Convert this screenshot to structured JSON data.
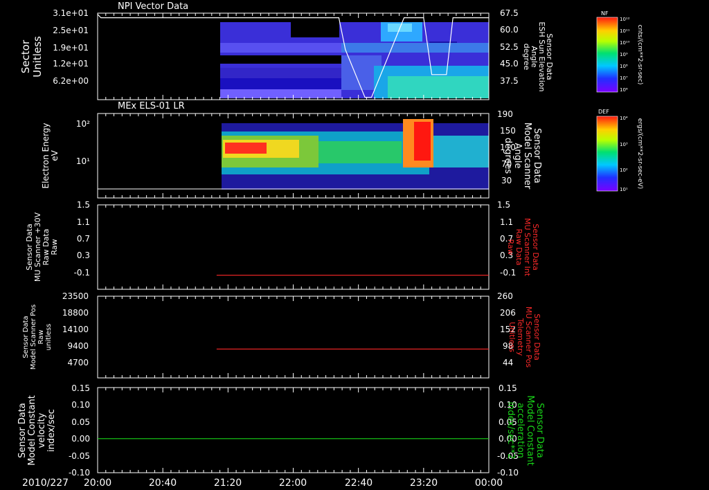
{
  "colors": {
    "background": "#000000",
    "axis": "#ffffff",
    "trace_red": "#ff2a2a",
    "trace_green": "#19d619",
    "trace_white": "#ffffff"
  },
  "xaxis": {
    "date_label": "2010/227",
    "ticks": [
      "20:00",
      "20:40",
      "21:20",
      "22:00",
      "22:40",
      "23:20",
      "00:00"
    ]
  },
  "panels": {
    "npi": {
      "title": "NPI Vector Data",
      "left_label": [
        "Sector",
        "Unitless"
      ],
      "left_ticks": [
        "3.1e+01",
        "2.5e+01",
        "1.9e+01",
        "1.2e+01",
        "6.2e+00"
      ],
      "right_label": [
        "Sensor Data",
        "ESH Sun Elevation",
        "Angle",
        "degree"
      ],
      "right_ticks": [
        "67.5",
        "60.0",
        "52.5",
        "45.0",
        "37.5"
      ]
    },
    "els": {
      "title": "MEx ELS-01 LR",
      "left_label": [
        "Electron Energy",
        "eV"
      ],
      "left_ticks": [
        "10²",
        "10¹"
      ],
      "right_label": [
        "Sensor Data",
        "Model Scanner",
        "Angle",
        "degrees"
      ],
      "right_ticks": [
        "190",
        "150",
        "110",
        "70",
        "30"
      ]
    },
    "mu_raw": {
      "left_label": [
        "Sensor Data",
        "MU Scanner +30V",
        "Raw Data",
        "Raw"
      ],
      "left_ticks": [
        "1.5",
        "1.1",
        "0.7",
        "0.3",
        "-0.1"
      ],
      "right_label": [
        "Sensor Data",
        "MU Scanner Int",
        "Raw Data",
        "Raw"
      ],
      "right_ticks": [
        "1.5",
        "1.1",
        "0.7",
        "0.3",
        "-0.1"
      ]
    },
    "pos": {
      "left_label": [
        "Sensor Data",
        "Model Scanner Pos",
        "Raw",
        "unitless"
      ],
      "left_ticks": [
        "23500",
        "18800",
        "14100",
        "9400",
        "4700"
      ],
      "right_label": [
        "Sensor Data",
        "MU Scanner Pos",
        "Telemetry",
        "Unitless"
      ],
      "right_ticks": [
        "260",
        "206",
        "152",
        "98",
        "44"
      ]
    },
    "vel": {
      "left_label": [
        "Sensor Data",
        "Model Constant",
        "velocity",
        "index/sec"
      ],
      "left_ticks": [
        "0.15",
        "0.10",
        "0.05",
        "0.00",
        "-0.05",
        "-0.10"
      ],
      "right_label": [
        "Sensor Data",
        "Model Constant",
        "acceleration",
        "index/sec**2"
      ],
      "right_ticks": [
        "0.15",
        "0.10",
        "0.05",
        "0.00",
        "-0.05",
        "-0.10"
      ]
    }
  },
  "colorbars": {
    "npi": {
      "title": "NF",
      "ticks": [
        "10¹²",
        "10¹¹",
        "10¹⁰",
        "10⁹",
        "10⁸",
        "10⁷",
        "10⁶"
      ],
      "unit": "cnts/(cm**2-sr-sec)"
    },
    "els": {
      "title": "DEF",
      "ticks": [
        "10⁴",
        "10³",
        "10²",
        "10¹"
      ],
      "unit": "ergs/(cm**2-sr-sec-eV)"
    }
  },
  "chart_data": [
    {
      "type": "heatmap",
      "title": "NPI Vector Data",
      "ylabel": "Sector Unitless",
      "y2label": "Sensor Data ESH Sun Elevation Angle degree",
      "xlim": [
        "20:00",
        "00:00"
      ],
      "data_start": "21:13",
      "ylim": [
        0,
        32
      ],
      "y2lim": [
        30,
        68
      ],
      "overlay_line_y2": {
        "x": [
          "20:00",
          "20:02",
          "22:28",
          "22:32",
          "22:44",
          "22:48",
          "23:08",
          "23:12",
          "23:20",
          "23:25",
          "23:34",
          "23:38",
          "00:00"
        ],
        "y": [
          67.5,
          66.0,
          66.0,
          52,
          31,
          31,
          66.0,
          66.0,
          66.0,
          41,
          41,
          66.0,
          66.0
        ]
      }
    },
    {
      "type": "heatmap",
      "title": "MEx ELS-01 LR",
      "ylabel": "Electron Energy eV",
      "y2label": "Sensor Data Model Scanner Angle degrees",
      "xlim": [
        "20:00",
        "00:00"
      ],
      "data_start": "21:13",
      "y_scale": "log",
      "ylim": [
        1,
        200
      ],
      "y2lim": [
        10,
        190
      ],
      "overlay_line_y2": {
        "x": [
          "20:00",
          "00:00"
        ],
        "y": [
          10,
          10
        ]
      }
    },
    {
      "type": "line",
      "ylabel": "Sensor Data MU Scanner +30V Raw Data Raw",
      "y2label": "Sensor Data MU Scanner Int Raw Data Raw",
      "ylim": [
        -0.3,
        1.5
      ],
      "series": [
        {
          "x": [
            "21:13",
            "00:00"
          ],
          "values": [
            0.0,
            0.0
          ],
          "color": "#ff2a2a"
        }
      ]
    },
    {
      "type": "line",
      "ylabel": "Sensor Data Model Scanner Pos Raw unitless",
      "y2label": "Sensor Data MU Scanner Pos Telemetry Unitless",
      "ylim": [
        0,
        23500
      ],
      "series": [
        {
          "x": [
            "21:13",
            "00:00"
          ],
          "values": [
            8300,
            8300
          ],
          "color": "#ff2a2a"
        }
      ]
    },
    {
      "type": "line",
      "ylabel": "Sensor Data Model Constant velocity index/sec",
      "y2label": "Sensor Data Model Constant acceleration index/sec**2",
      "ylim": [
        -0.1,
        0.15
      ],
      "series": [
        {
          "x": [
            "20:00",
            "00:00"
          ],
          "values": [
            0.0,
            0.0
          ],
          "color": "#19d619"
        }
      ]
    }
  ]
}
